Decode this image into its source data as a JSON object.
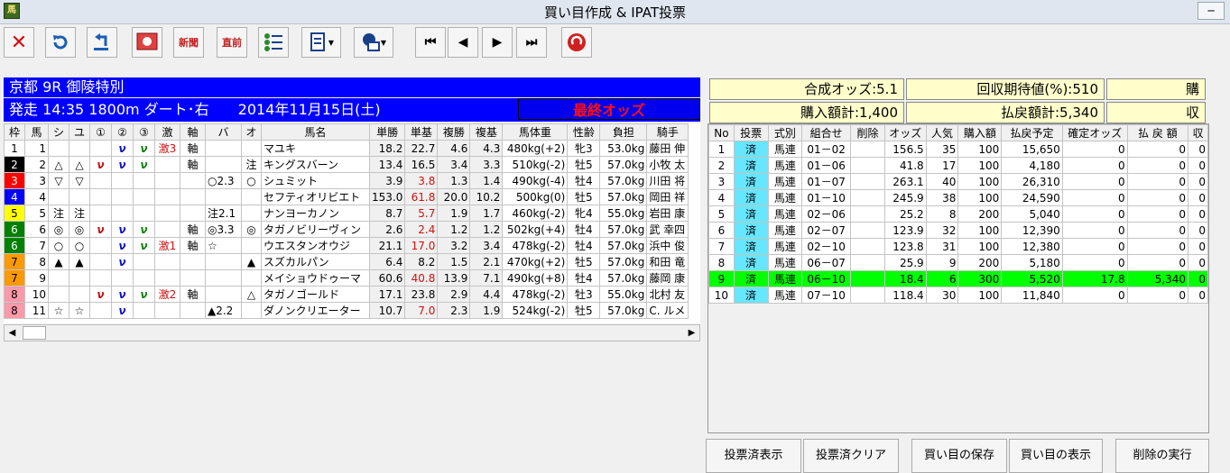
{
  "window": {
    "title": "買い目作成 & IPAT投票",
    "icon_name": "horse-app-icon",
    "min_label": "─"
  },
  "toolbar": {
    "newspaper_label": "新聞",
    "chokuzen_label": "直前"
  },
  "race": {
    "header": "京都 9R 御陵特別",
    "start": "発走 14:35 1800m ダート･右　　2014年11月15日(土)",
    "odds_status": "最終オッズ"
  },
  "summary": {
    "gosei": "合成オッズ:5.1",
    "kaishu": "回収期待値(%):510",
    "kounyu": "購入額計:1,400",
    "haraimodoshi": "払戻額計:5,340",
    "extra1": "購",
    "extra2": "収"
  },
  "horses": {
    "columns": [
      "枠",
      "馬",
      "シ",
      "ユ",
      "①",
      "②",
      "③",
      "激",
      "軸",
      "バ",
      "オ",
      "馬名",
      "単勝",
      "単基",
      "複勝",
      "複基",
      "馬体重",
      "性齢",
      "負担",
      "騎手"
    ],
    "rows": [
      {
        "waku": "1",
        "uma": "1",
        "shi": "",
        "yu": "",
        "m1": "",
        "m2": "ν",
        "m3": "ν",
        "geki": "激3",
        "jiku": "軸",
        "ba": "",
        "o": "",
        "name": "マユキ",
        "tan": "18.2",
        "tanki": "22.7",
        "fuku": "4.6",
        "fukuki": "4.3",
        "weight": "480kg(+2)",
        "sexage": "牝3",
        "futan": "53.0kg",
        "jockey": "藤田 伸"
      },
      {
        "waku": "2",
        "uma": "2",
        "shi": "△",
        "yu": "△",
        "m1": "ν",
        "m2": "ν",
        "m3": "ν",
        "geki": "",
        "jiku": "軸",
        "ba": "",
        "o": "注",
        "name": "キングスバーン",
        "tan": "13.4",
        "tanki": "16.5",
        "fuku": "3.4",
        "fukuki": "3.3",
        "weight": "510kg(-2)",
        "sexage": "牡5",
        "futan": "57.0kg",
        "jockey": "小牧 太"
      },
      {
        "waku": "3",
        "uma": "3",
        "shi": "▽",
        "yu": "▽",
        "m1": "",
        "m2": "",
        "m3": "",
        "geki": "",
        "jiku": "",
        "ba": "○2.3",
        "o": "○",
        "name": "シュミット",
        "tan": "3.9",
        "tanki": "3.8",
        "fuku": "1.3",
        "fukuki": "1.4",
        "weight": "490kg(-4)",
        "sexage": "牡4",
        "futan": "57.0kg",
        "jockey": "川田 将"
      },
      {
        "waku": "4",
        "uma": "4",
        "shi": "",
        "yu": "",
        "m1": "",
        "m2": "",
        "m3": "",
        "geki": "",
        "jiku": "",
        "ba": "",
        "o": "",
        "name": "セフティオリビエト",
        "tan": "153.0",
        "tanki": "61.8",
        "fuku": "20.0",
        "fukuki": "10.2",
        "weight": "500kg(0)",
        "sexage": "牡5",
        "futan": "57.0kg",
        "jockey": "岡田 祥"
      },
      {
        "waku": "5",
        "uma": "5",
        "shi": "注",
        "yu": "注",
        "m1": "",
        "m2": "",
        "m3": "",
        "geki": "",
        "jiku": "",
        "ba": "注2.1",
        "o": "",
        "name": "ナンヨーカノン",
        "tan": "8.7",
        "tanki": "5.7",
        "fuku": "1.9",
        "fukuki": "1.7",
        "weight": "460kg(-2)",
        "sexage": "牝4",
        "futan": "55.0kg",
        "jockey": "岩田 康"
      },
      {
        "waku": "6",
        "uma": "6",
        "shi": "◎",
        "yu": "◎",
        "m1": "ν",
        "m2": "ν",
        "m3": "ν",
        "geki": "",
        "jiku": "軸",
        "ba": "◎3.3",
        "o": "◎",
        "name": "タガノビリーヴィン",
        "tan": "2.6",
        "tanki": "2.4",
        "fuku": "1.2",
        "fukuki": "1.2",
        "weight": "502kg(+4)",
        "sexage": "牡4",
        "futan": "57.0kg",
        "jockey": "武 幸四"
      },
      {
        "waku": "6",
        "uma": "7",
        "shi": "○",
        "yu": "○",
        "m1": "",
        "m2": "ν",
        "m3": "ν",
        "geki": "激1",
        "jiku": "軸",
        "ba": "☆",
        "o": "",
        "name": "ウエスタンオウジ",
        "tan": "21.1",
        "tanki": "17.0",
        "fuku": "3.2",
        "fukuki": "3.4",
        "weight": "478kg(-2)",
        "sexage": "牡4",
        "futan": "57.0kg",
        "jockey": "浜中 俊"
      },
      {
        "waku": "7",
        "uma": "8",
        "shi": "▲",
        "yu": "▲",
        "m1": "",
        "m2": "ν",
        "m3": "",
        "geki": "",
        "jiku": "",
        "ba": "",
        "o": "▲",
        "name": "スズカルパン",
        "tan": "6.4",
        "tanki": "8.2",
        "fuku": "1.5",
        "fukuki": "2.1",
        "weight": "470kg(+2)",
        "sexage": "牡5",
        "futan": "57.0kg",
        "jockey": "和田 竜"
      },
      {
        "waku": "7",
        "uma": "9",
        "shi": "",
        "yu": "",
        "m1": "",
        "m2": "",
        "m3": "",
        "geki": "",
        "jiku": "",
        "ba": "",
        "o": "",
        "name": "メイショウドゥーマ",
        "tan": "60.6",
        "tanki": "40.8",
        "fuku": "13.9",
        "fukuki": "7.1",
        "weight": "490kg(+8)",
        "sexage": "牡4",
        "futan": "57.0kg",
        "jockey": "藤岡 康"
      },
      {
        "waku": "8",
        "uma": "10",
        "shi": "",
        "yu": "",
        "m1": "ν",
        "m2": "ν",
        "m3": "ν",
        "geki": "激2",
        "jiku": "軸",
        "ba": "",
        "o": "△",
        "name": "タガノゴールド",
        "tan": "17.1",
        "tanki": "23.8",
        "fuku": "2.9",
        "fukuki": "4.4",
        "weight": "478kg(-2)",
        "sexage": "牡3",
        "futan": "55.0kg",
        "jockey": "北村 友"
      },
      {
        "waku": "8",
        "uma": "11",
        "shi": "☆",
        "yu": "☆",
        "m1": "",
        "m2": "ν",
        "m3": "",
        "geki": "",
        "jiku": "",
        "ba": "▲2.2",
        "o": "",
        "name": "ダノンクリエーター",
        "tan": "10.7",
        "tanki": "7.0",
        "fuku": "2.3",
        "fukuki": "1.9",
        "weight": "524kg(-2)",
        "sexage": "牡5",
        "futan": "57.0kg",
        "jockey": "C. ルメ"
      }
    ]
  },
  "bets": {
    "columns": [
      "No",
      "投票",
      "式別",
      "組合せ",
      "削除",
      "オッズ",
      "人気",
      "購入額",
      "払戻予定",
      "確定オッズ",
      "払 戻 額",
      "収"
    ],
    "rows": [
      {
        "no": "1",
        "tou": "済",
        "shiki": "馬連",
        "kumi": "01－02",
        "del": "",
        "odds": "156.5",
        "ninki": "35",
        "kounyu": "100",
        "yotei": "15,650",
        "kakutei": "0",
        "harai": "0",
        "shu": "0"
      },
      {
        "no": "2",
        "tou": "済",
        "shiki": "馬連",
        "kumi": "01－06",
        "del": "",
        "odds": "41.8",
        "ninki": "17",
        "kounyu": "100",
        "yotei": "4,180",
        "kakutei": "0",
        "harai": "0",
        "shu": "0"
      },
      {
        "no": "3",
        "tou": "済",
        "shiki": "馬連",
        "kumi": "01－07",
        "del": "",
        "odds": "263.1",
        "ninki": "40",
        "kounyu": "100",
        "yotei": "26,310",
        "kakutei": "0",
        "harai": "0",
        "shu": "0"
      },
      {
        "no": "4",
        "tou": "済",
        "shiki": "馬連",
        "kumi": "01－10",
        "del": "",
        "odds": "245.9",
        "ninki": "38",
        "kounyu": "100",
        "yotei": "24,590",
        "kakutei": "0",
        "harai": "0",
        "shu": "0"
      },
      {
        "no": "5",
        "tou": "済",
        "shiki": "馬連",
        "kumi": "02－06",
        "del": "",
        "odds": "25.2",
        "ninki": "8",
        "kounyu": "200",
        "yotei": "5,040",
        "kakutei": "0",
        "harai": "0",
        "shu": "0"
      },
      {
        "no": "6",
        "tou": "済",
        "shiki": "馬連",
        "kumi": "02－07",
        "del": "",
        "odds": "123.9",
        "ninki": "32",
        "kounyu": "100",
        "yotei": "12,390",
        "kakutei": "0",
        "harai": "0",
        "shu": "0"
      },
      {
        "no": "7",
        "tou": "済",
        "shiki": "馬連",
        "kumi": "02－10",
        "del": "",
        "odds": "123.8",
        "ninki": "31",
        "kounyu": "100",
        "yotei": "12,380",
        "kakutei": "0",
        "harai": "0",
        "shu": "0"
      },
      {
        "no": "8",
        "tou": "済",
        "shiki": "馬連",
        "kumi": "06－07",
        "del": "",
        "odds": "25.9",
        "ninki": "9",
        "kounyu": "200",
        "yotei": "5,180",
        "kakutei": "0",
        "harai": "0",
        "shu": "0"
      },
      {
        "no": "9",
        "tou": "済",
        "shiki": "馬連",
        "kumi": "06－10",
        "del": "",
        "odds": "18.4",
        "ninki": "6",
        "kounyu": "300",
        "yotei": "5,520",
        "kakutei": "17.8",
        "harai": "5,340",
        "shu": "0"
      },
      {
        "no": "10",
        "tou": "済",
        "shiki": "馬連",
        "kumi": "07－10",
        "del": "",
        "odds": "118.4",
        "ninki": "30",
        "kounyu": "100",
        "yotei": "11,840",
        "kakutei": "0",
        "harai": "0",
        "shu": "0"
      }
    ]
  },
  "buttons": {
    "show_voted": "投票済表示",
    "clear_voted": "投票済クリア",
    "save": "買い目の保存",
    "show": "買い目の表示",
    "delete": "削除の実行"
  },
  "colors": {
    "waku": [
      "#ffffff",
      "#000000",
      "#ff0000",
      "#0000ff",
      "#ffff00",
      "#008000",
      "#ff9900",
      "#ff99aa"
    ],
    "header_blue": "#0000ff",
    "selected_row": "#00ff00"
  }
}
